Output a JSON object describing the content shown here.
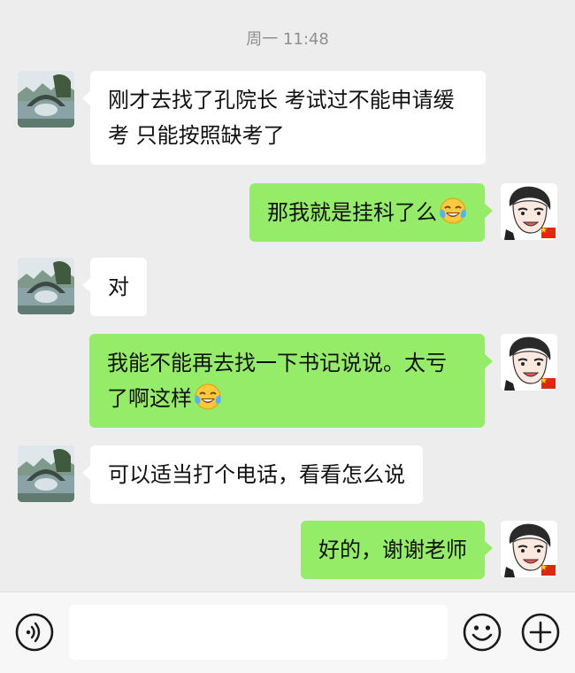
{
  "timestamp": "周一 11:48",
  "messages": [
    {
      "from": "teacher",
      "text": "刚才去找了孔院长  考试过不能申请缓考  只能按照缺考了"
    },
    {
      "from": "me",
      "text": "那我就是挂科了么",
      "emoji": "face-with-tears-emoji"
    },
    {
      "from": "teacher",
      "text": "对"
    },
    {
      "from": "me",
      "text": "我能不能再去找一下书记说说。太亏了啊这样",
      "emoji": "face-with-tears-emoji"
    },
    {
      "from": "teacher",
      "text": "可以适当打个电话，看看怎么说"
    },
    {
      "from": "me",
      "text": "好的，谢谢老师"
    }
  ],
  "input_bar": {
    "voice_icon": "voice-icon",
    "emoji_icon": "smiley-icon",
    "add_icon": "plus-icon",
    "message_value": ""
  }
}
